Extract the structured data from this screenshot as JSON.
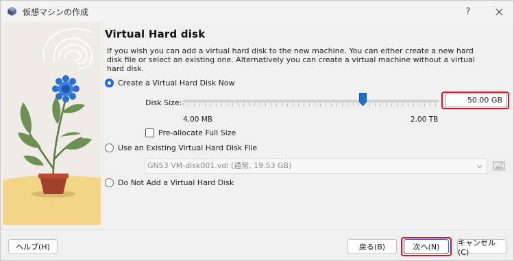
{
  "window": {
    "title": "仮想マシンの作成",
    "help_glyph": "?"
  },
  "page": {
    "heading": "Virtual Hard disk",
    "description": "If you wish you can add a virtual hard disk to the new machine. You can either create a new hard disk file or select an existing one. Alternatively you can create a virtual machine without a virtual hard disk."
  },
  "options": {
    "create_new": {
      "label": "Create a Virtual Hard Disk Now",
      "selected": true
    },
    "use_existing": {
      "label": "Use an Existing Virtual Hard Disk File",
      "selected": false
    },
    "no_disk": {
      "label": "Do Not Add a Virtual Hard Disk",
      "selected": false
    }
  },
  "disk_size": {
    "label": "Disk Size:",
    "value": "50.00 GB",
    "min_label": "4.00 MB",
    "max_label": "2.00 TB",
    "slider_fraction": 0.7
  },
  "preallocate": {
    "label": "Pre-allocate Full Size",
    "checked": false
  },
  "existing_file": {
    "selected": "GNS3 VM-disk001.vdi (通常, 19.53 GB)"
  },
  "buttons": {
    "help": "ヘルプ(H)",
    "back": "戻る(B)",
    "next": "次へ(N)",
    "cancel": "キャンセル(C)"
  },
  "colors": {
    "accent": "#1e6fd0",
    "highlight": "#e0102a"
  }
}
